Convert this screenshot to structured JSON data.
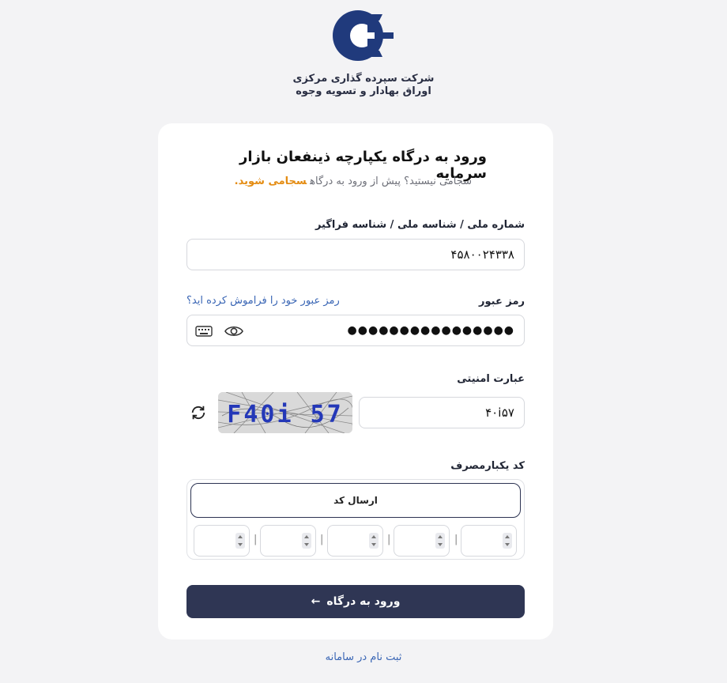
{
  "org": {
    "name_line1": "شرکت سپرده گذاری مرکزی",
    "name_line2": "اوراق بهادار و تسویه وجوه",
    "brand_color": "#203a7c"
  },
  "login": {
    "title": "ورود به درگاه یکپارچه ذینفعان بازار سرمایه",
    "subtitle": "سجامی نیستید؟ پیش از ورود به درگاه",
    "subtitle_link": "سجامی شوید."
  },
  "national_id": {
    "label": "شماره ملی / شناسه ملی / شناسه فراگیر",
    "value": "۴۵۸۰۰۲۴۳۳۸"
  },
  "password": {
    "label": "رمز عبور",
    "forgot": "رمز عبور خود را فراموش کرده اید؟",
    "masked_value": "●●●●●●●●●●●●●●●●"
  },
  "captcha": {
    "label": "عبارت امنیتی",
    "value": "۴۰i۵۷",
    "image_text": "F40i 57"
  },
  "otp": {
    "label": "کد یکبارمصرف",
    "send_label": "ارسال کد",
    "digits": [
      "",
      "",
      "",
      "",
      ""
    ],
    "separator": "|"
  },
  "submit": {
    "label": "ورود به درگاه",
    "arrow": "←"
  },
  "footer": {
    "register": "ثبت نام در سامانه"
  },
  "colors": {
    "primary": "#2f3654",
    "accent": "#e48c12",
    "link": "#3a66b5"
  }
}
